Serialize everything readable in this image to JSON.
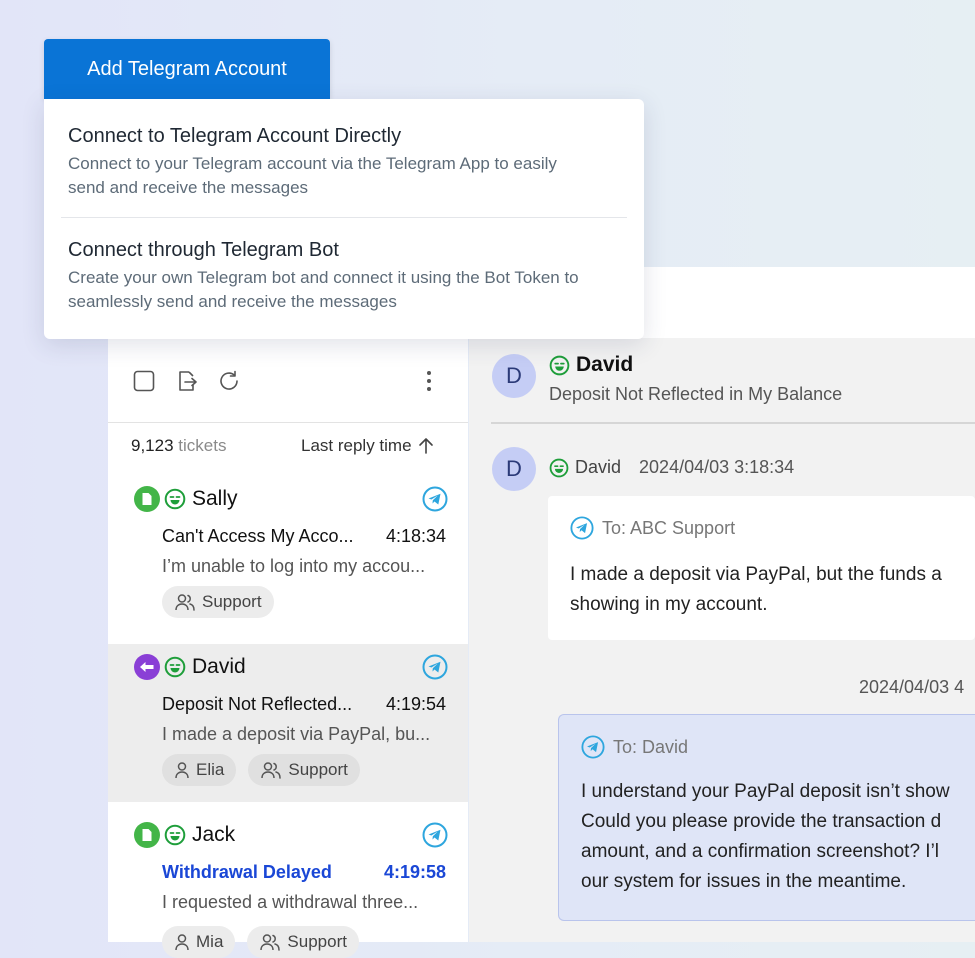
{
  "add_button": {
    "label": "Add Telegram Account"
  },
  "menu": {
    "options": [
      {
        "title": "Connect to Telegram Account Directly",
        "description_lines": [
          "Connect to your Telegram account via the Telegram App to easily",
          "send and receive the messages"
        ]
      },
      {
        "title": "Connect through Telegram Bot",
        "description_lines": [
          "Create your own Telegram bot and connect it using the Bot Token to",
          "seamlessly send and receive the messages"
        ]
      }
    ]
  },
  "toolbar": {
    "icons": [
      "checkbox-icon",
      "export-icon",
      "refresh-icon",
      "more-vertical-icon"
    ]
  },
  "list": {
    "count": "9,123",
    "count_unit": "tickets",
    "sort_label": "Last reply time",
    "tickets": [
      {
        "name": "Sally",
        "status_icon": "document-icon",
        "subject": "Can't Access My Acco...",
        "time": "4:18:34",
        "preview": "I’m unable to log into my accou...",
        "tags": [
          "Support"
        ],
        "unread": false
      },
      {
        "name": "David",
        "status_icon": "reply-arrow-icon",
        "subject": "Deposit Not Reflected...",
        "time": "4:19:54",
        "preview": "I made a deposit via PayPal, bu...",
        "tags": [
          "Elia",
          "Support"
        ],
        "unread": false,
        "selected": true
      },
      {
        "name": "Jack",
        "status_icon": "document-icon",
        "subject": "Withdrawal Delayed",
        "time": "4:19:58",
        "preview": "I requested a withdrawal three...",
        "tags": [
          "Mia",
          "Support"
        ],
        "unread": true
      }
    ]
  },
  "conversation": {
    "avatar_letter": "D",
    "name": "David",
    "subject": "Deposit Not Reflected in My Balance",
    "message": {
      "sender": "David",
      "timestamp": "2024/04/03 3:18:34",
      "to": "To: ABC Support",
      "lines": [
        "I made a deposit via PayPal, but the funds a",
        "showing in my account."
      ]
    },
    "reply": {
      "timestamp": "2024/04/03 4",
      "to": "To: David",
      "lines": [
        "I understand your PayPal deposit isn’t show",
        "Could you please provide the transaction d",
        "amount, and a confirmation screenshot? I’l",
        "our system for issues in the meantime."
      ]
    }
  },
  "colors": {
    "primary": "#0a74d6",
    "telegram": "#2ea6de",
    "mood_green": "#1e9e3a",
    "status_green": "#43b548",
    "status_purple": "#8a3fd6",
    "unread_blue": "#1a47d6"
  }
}
